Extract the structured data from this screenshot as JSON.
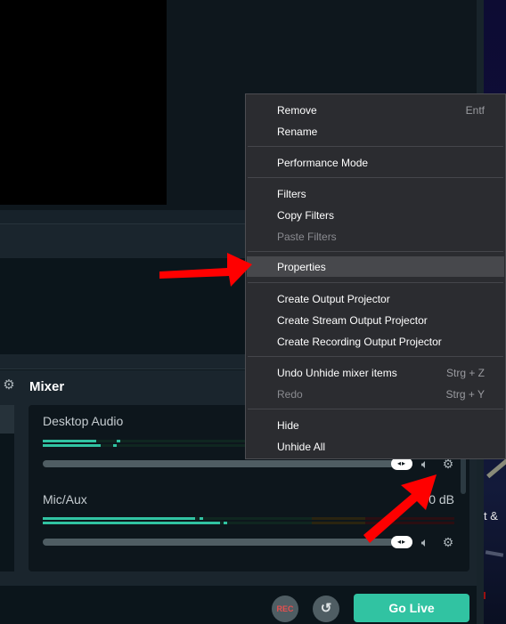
{
  "context_menu": {
    "items": [
      {
        "label": "Remove",
        "shortcut": "Entf",
        "disabled": false
      },
      {
        "label": "Rename",
        "shortcut": "",
        "disabled": false
      },
      {
        "label": "Performance Mode",
        "shortcut": "",
        "disabled": false
      },
      {
        "label": "Filters",
        "shortcut": "",
        "disabled": false
      },
      {
        "label": "Copy Filters",
        "shortcut": "",
        "disabled": false
      },
      {
        "label": "Paste Filters",
        "shortcut": "",
        "disabled": true
      },
      {
        "label": "Properties",
        "shortcut": "",
        "disabled": false,
        "highlighted": true
      },
      {
        "label": "Create Output Projector",
        "shortcut": "",
        "disabled": false
      },
      {
        "label": "Create Stream Output Projector",
        "shortcut": "",
        "disabled": false
      },
      {
        "label": "Create Recording Output Projector",
        "shortcut": "",
        "disabled": false
      },
      {
        "label": "Undo Unhide mixer items",
        "shortcut": "Strg + Z",
        "disabled": false
      },
      {
        "label": "Redo",
        "shortcut": "Strg + Y",
        "disabled": true
      },
      {
        "label": "Hide",
        "shortcut": "",
        "disabled": false
      },
      {
        "label": "Unhide All",
        "shortcut": "",
        "disabled": false
      }
    ]
  },
  "mixer": {
    "title": "Mixer",
    "settings_icon": "gear-icon",
    "channels": [
      {
        "name": "Desktop Audio",
        "db": "",
        "meter_levels": [
          0.13,
          0.14
        ],
        "peaks": [
          0.18,
          0.17
        ],
        "volume": 1.0
      },
      {
        "name": "Mic/Aux",
        "db": "0.0 dB",
        "meter_levels": [
          0.37,
          0.43
        ],
        "peaks": [
          0.38,
          0.44
        ],
        "volume": 1.0
      }
    ],
    "channel_icons": {
      "thumb": "◂▸",
      "mute": "speaker-icon",
      "settings": "gear-icon"
    }
  },
  "controls": {
    "rec_label": "REC",
    "replay_icon": "replay-icon",
    "go_live_label": "Go Live"
  },
  "background_caption": "t &",
  "colors": {
    "accent": "#31c3a2",
    "rec": "#e84f4f",
    "menu_bg": "#2b2c30",
    "annotation_arrow": "#ff0000"
  }
}
